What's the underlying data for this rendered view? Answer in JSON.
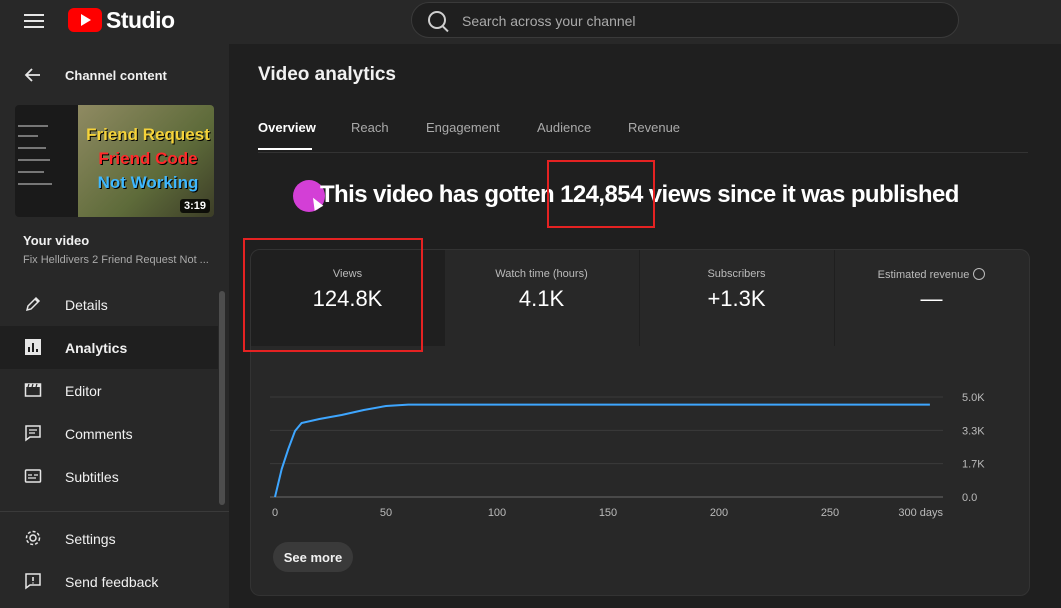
{
  "header": {
    "logo_text": "Studio",
    "search_placeholder": "Search across your channel"
  },
  "sidebar": {
    "back_label": "Channel content",
    "thumbnail": {
      "line1": "Friend Request",
      "line2": "Friend Code",
      "line3": "Not Working",
      "duration": "3:19"
    },
    "your_video_label": "Your video",
    "video_title": "Fix Helldivers 2 Friend Request Not ...",
    "items": [
      {
        "label": "Details",
        "icon": "pencil-icon"
      },
      {
        "label": "Analytics",
        "icon": "analytics-icon",
        "active": true
      },
      {
        "label": "Editor",
        "icon": "clapper-icon"
      },
      {
        "label": "Comments",
        "icon": "comment-icon"
      },
      {
        "label": "Subtitles",
        "icon": "subtitles-icon"
      }
    ],
    "bottom_items": [
      {
        "label": "Settings",
        "icon": "gear-icon"
      },
      {
        "label": "Send feedback",
        "icon": "feedback-icon"
      }
    ]
  },
  "main": {
    "title": "Video analytics",
    "tabs": [
      {
        "label": "Overview",
        "active": true
      },
      {
        "label": "Reach"
      },
      {
        "label": "Engagement"
      },
      {
        "label": "Audience"
      },
      {
        "label": "Revenue"
      }
    ],
    "headline": "This video has gotten 124,854 views since it was published",
    "metrics": [
      {
        "label": "Views",
        "value": "124.8K"
      },
      {
        "label": "Watch time (hours)",
        "value": "4.1K"
      },
      {
        "label": "Subscribers",
        "value": "+1.3K"
      },
      {
        "label": "Estimated revenue",
        "value": "—"
      }
    ],
    "see_more_label": "See more"
  },
  "colors": {
    "line": "#3ea6ff",
    "highlight_box": "#e52222",
    "cursor": "#d33fd6"
  },
  "chart_data": {
    "type": "line",
    "x_ticks": [
      "0",
      "50",
      "100",
      "150",
      "200",
      "250",
      "300 days"
    ],
    "y_ticks": [
      "0.0",
      "1.7K",
      "3.3K",
      "5.0K"
    ],
    "xlim": [
      0,
      300
    ],
    "ylim": [
      0,
      5000
    ],
    "grid": true,
    "series": [
      {
        "x": [
          0,
          3,
          6,
          9,
          12,
          20,
          30,
          40,
          50,
          60,
          80,
          100,
          150,
          200,
          250,
          295
        ],
        "y": [
          0,
          1400,
          2400,
          3300,
          3700,
          3900,
          4100,
          4350,
          4550,
          4620,
          4620,
          4620,
          4620,
          4620,
          4620,
          4620
        ]
      }
    ]
  }
}
